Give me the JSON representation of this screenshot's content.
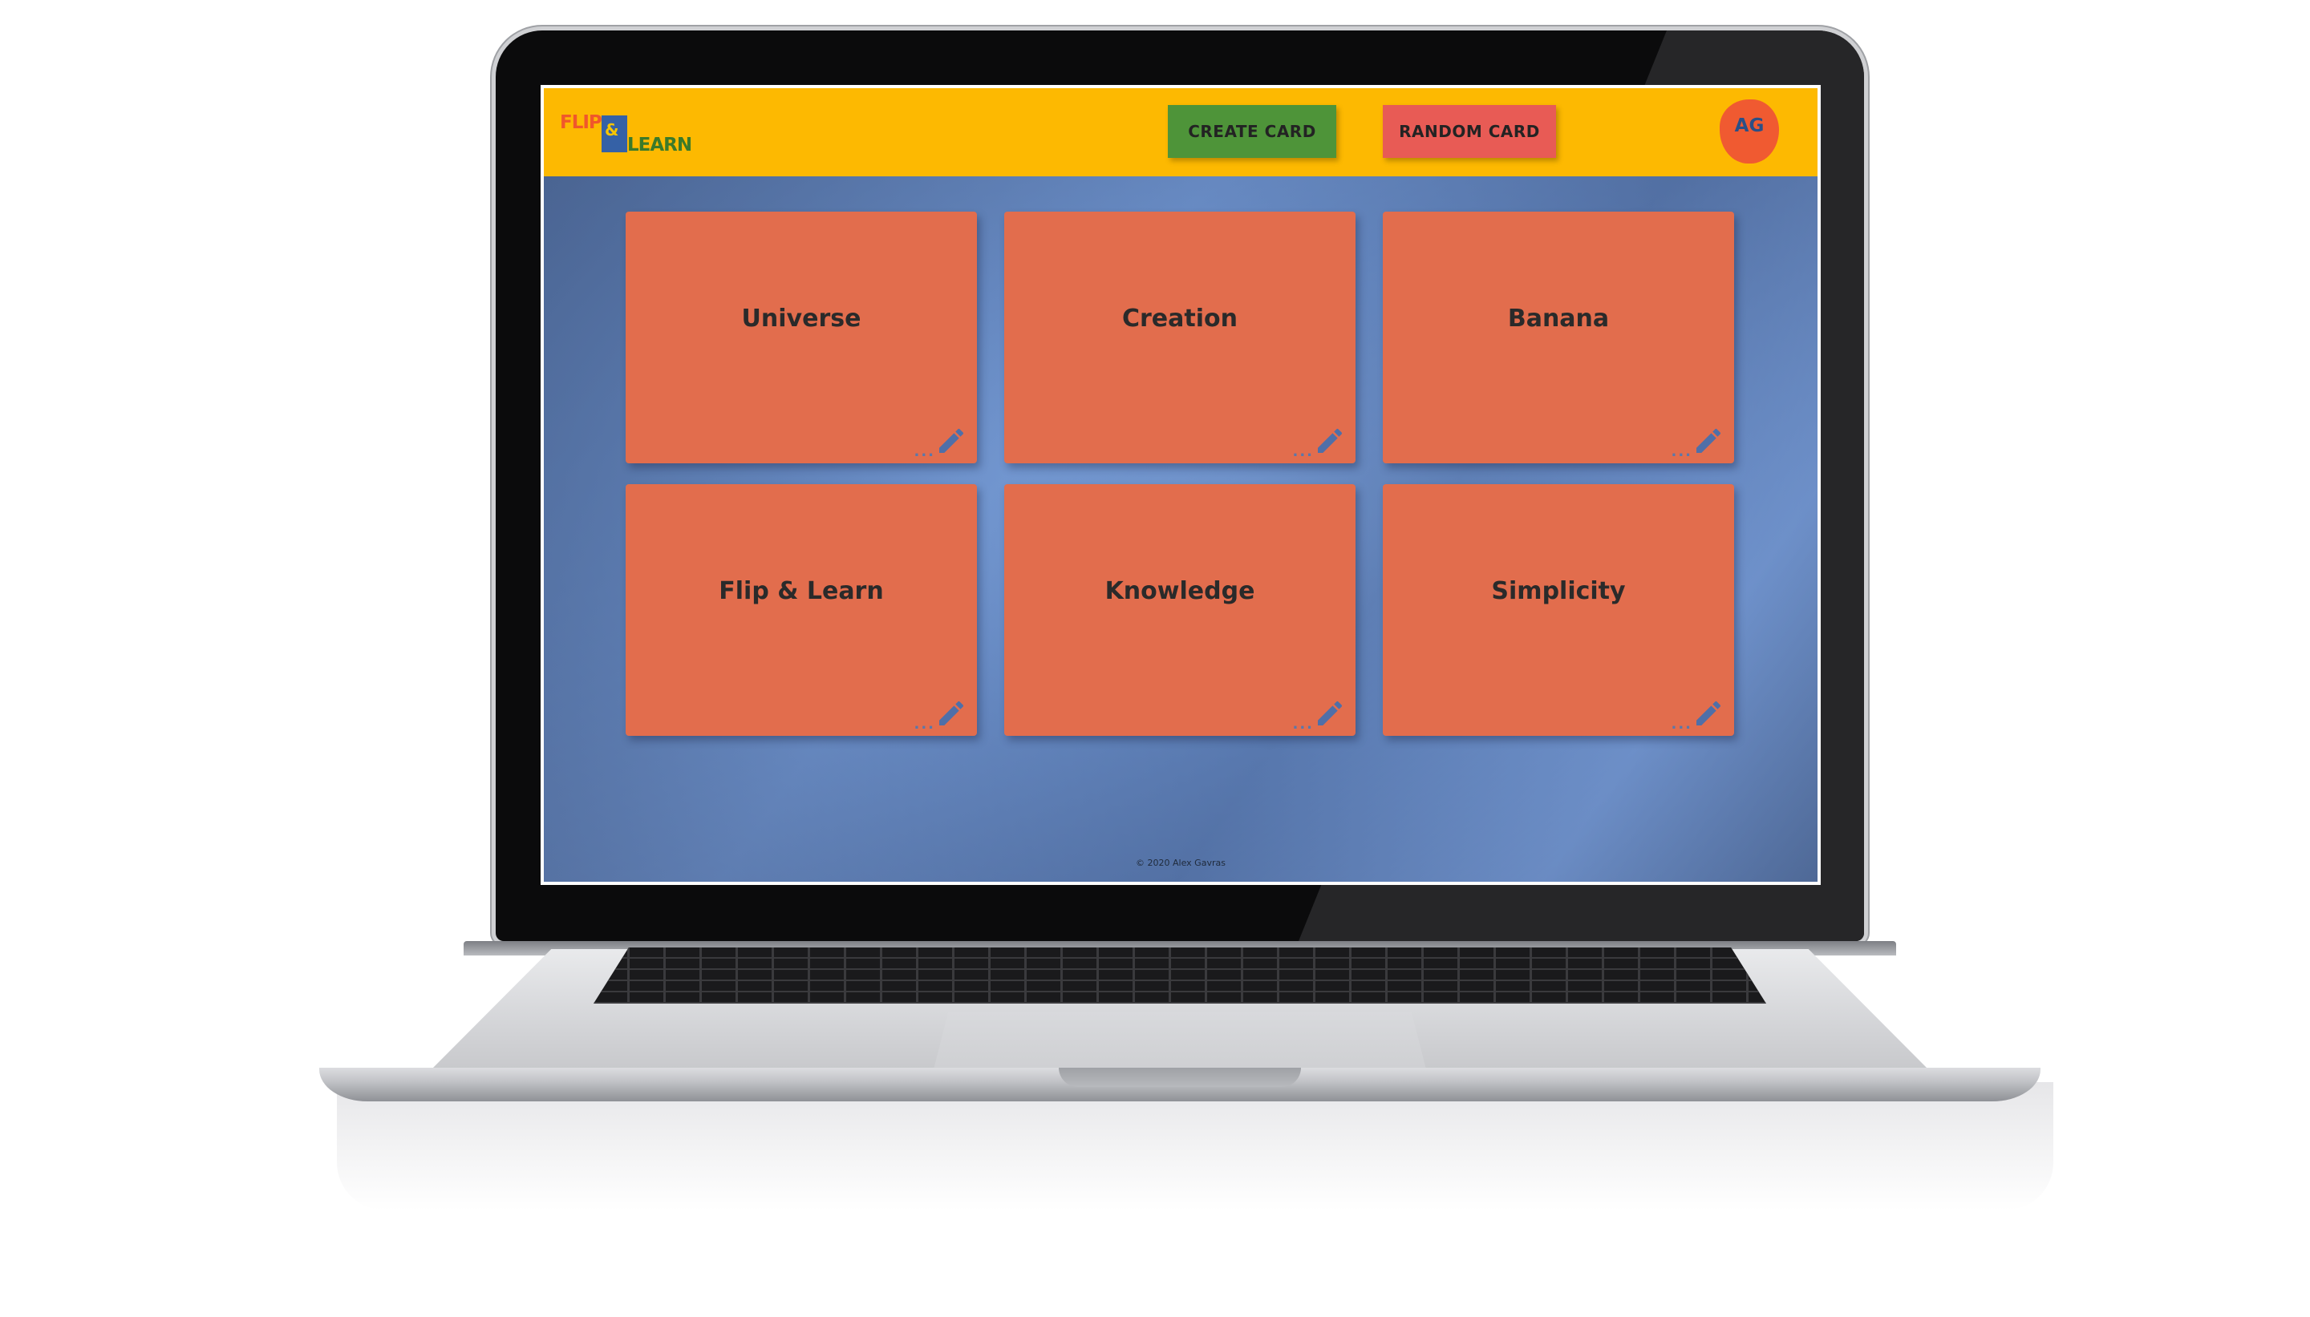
{
  "header": {
    "logo": {
      "flip": "FLIP",
      "ampersand": "&",
      "learn": "LEARN"
    },
    "create_button_label": "CREATE CARD",
    "random_button_label": "RANDOM CARD",
    "avatar_initials": "AG"
  },
  "cards": [
    {
      "title": "Universe",
      "more": "..."
    },
    {
      "title": "Creation",
      "more": "..."
    },
    {
      "title": "Banana",
      "more": "..."
    },
    {
      "title": "Flip & Learn",
      "more": "..."
    },
    {
      "title": "Knowledge",
      "more": "..."
    },
    {
      "title": "Simplicity",
      "more": "..."
    }
  ],
  "footer": {
    "copyright": "© 2020 Alex Gavras"
  },
  "icons": {
    "edit": "pencil-icon",
    "more": "ellipsis-icon"
  },
  "colors": {
    "header_bg": "#fdb901",
    "card_bg": "#e26d4d",
    "create_button": "#4e9439",
    "random_button": "#e85b55",
    "avatar_bg": "#f05a31",
    "background": "#6a8cc4"
  }
}
